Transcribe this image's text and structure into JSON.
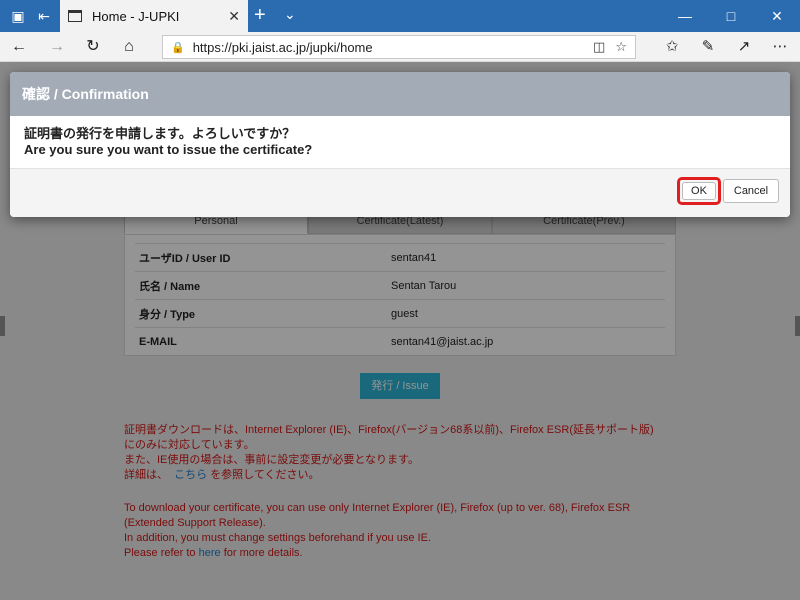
{
  "browser": {
    "tab_title": "Home - J-UPKI",
    "url": "https://pki.jaist.ac.jp/jupki/home",
    "icons": {
      "tab_actions": "tab-actions-icon",
      "set_aside": "set-aside-tabs-icon",
      "page": "page-icon",
      "close_tab": "close-icon",
      "new_tab": "plus-icon",
      "tab_menu": "chevron-down-icon",
      "back": "arrow-left-icon",
      "forward": "arrow-right-icon",
      "refresh": "refresh-icon",
      "home": "home-icon",
      "lock": "lock-icon",
      "reading_view": "book-icon",
      "favorite": "star-icon",
      "favorites_hub": "favorites-list-icon",
      "notes": "pen-icon",
      "share": "share-icon",
      "more": "more-icon"
    }
  },
  "modal": {
    "title": "確認 / Confirmation",
    "message_ja": "証明書の発行を申請します。よろしいですか？",
    "message_en": "Are you sure you want to issue the certificate?",
    "ok_label": "OK",
    "cancel_label": "Cancel",
    "highlight_color": "#e02020"
  },
  "page": {
    "tabs": [
      "Personal",
      "Certificate(Latest)",
      "Certificate(Prev.)"
    ],
    "rows": [
      {
        "label": "ユーザID / User ID",
        "value": "sentan41"
      },
      {
        "label": "氏名 / Name",
        "value": "Sentan Tarou"
      },
      {
        "label": "身分 / Type",
        "value": "guest"
      },
      {
        "label": "E-MAIL",
        "value": "sentan41@jaist.ac.jp"
      }
    ],
    "issue_button": "発行 / Issue",
    "notice_ja_1": "証明書ダウンロードは、Internet Explorer (IE)、Firefox(バージョン68系以前)、Firefox ESR(延長サポート版)",
    "notice_ja_2": "にのみに対応しています。",
    "notice_ja_3": "また、IE使用の場合は、事前に設定変更が必要となります。",
    "notice_ja_4a": "詳細は、",
    "notice_ja_4_link": "こちら",
    "notice_ja_4b": "を参照してください。",
    "notice_en_1": "To download your certificate, you can use only Internet Explorer (IE), Firefox (up to ver. 68), Firefox ESR",
    "notice_en_2": "(Extended Support Release).",
    "notice_en_3": "In addition, you must change settings beforehand if you use IE.",
    "notice_en_4a": "Please refer to",
    "notice_en_4_link": "here",
    "notice_en_4b": "for more details."
  }
}
